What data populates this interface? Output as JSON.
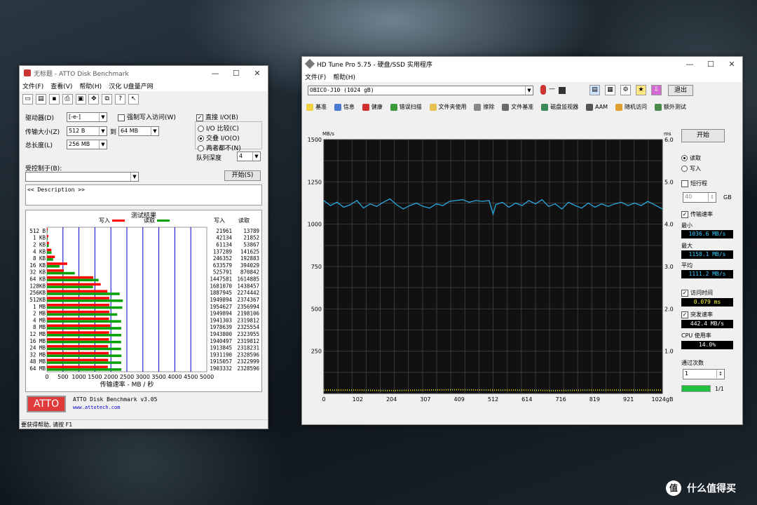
{
  "atto": {
    "title": "无标题 - ATTO Disk Benchmark",
    "menu": [
      "文件(F)",
      "查看(V)",
      "帮助(H)",
      "汉化 U盘量产网"
    ],
    "drive_label": "驱动器(D)",
    "drive_value": "[-e-]",
    "force_write_label": "强制写入访问(W)",
    "direct_io_label": "直接 I/O(B)",
    "transfer_label": "传输大小(Z)",
    "transfer_from": "512 B",
    "transfer_to_label": "到",
    "transfer_to": "64 MB",
    "total_label": "总长度(L)",
    "total_value": "256 MB",
    "io_compare": "I/O 比较(C)",
    "io_overlap": "交叠 I/O(O)",
    "io_neither": "两者都不(N)",
    "queue_label": "队列深度",
    "queue_value": "4",
    "controlled_label": "受控制于(B):",
    "start_button": "开始(S)",
    "description": "<< Description >>",
    "results_title": "测试结果",
    "legend_write": "写入",
    "legend_read": "读取",
    "col_write": "写入",
    "col_read": "读取",
    "sizes": [
      "512 B",
      "1 KB",
      "2 KB",
      "4 KB",
      "8 KB",
      "16 KB",
      "32 KB",
      "64 KB",
      "128KB",
      "256KB",
      "512KB",
      "1 MB",
      "2 MB",
      "4 MB",
      "8 MB",
      "12 MB",
      "16 MB",
      "24 MB",
      "32 MB",
      "48 MB",
      "64 MB"
    ],
    "write": [
      "21961",
      "42134",
      "61134",
      "137289",
      "246352",
      "633579",
      "525791",
      "1447581",
      "1681070",
      "1887945",
      "1949894",
      "1954627",
      "1949894",
      "1941303",
      "1978639",
      "1943800",
      "1940497",
      "1913845",
      "1931190",
      "1915057",
      "1903332"
    ],
    "read": [
      "13789",
      "21852",
      "53867",
      "141625",
      "192883",
      "394029",
      "870842",
      "1614885",
      "1438457",
      "2274442",
      "2374367",
      "2356994",
      "2198106",
      "2319812",
      "2325554",
      "2323955",
      "2319812",
      "2318231",
      "2328596",
      "2322999",
      "2328596"
    ],
    "x_ticks": [
      "0",
      "500",
      "1000",
      "1500",
      "2000",
      "2500",
      "3000",
      "3500",
      "4000",
      "4500",
      "5000"
    ],
    "x_axis_label": "传输速率 - MB / 秒",
    "logo": "ATTO",
    "product": "ATTO Disk Benchmark v3.05",
    "url": "www.attotech.com",
    "status": "要获得帮助, 请按 F1",
    "colors": {
      "write": "#ff0000",
      "read": "#00a000",
      "grid": "#0000cc"
    }
  },
  "hdtune": {
    "title": "HD Tune Pro 5.75 - 硬盘/SSD 实用程序",
    "menu": [
      "文件(F)",
      "帮助(H)"
    ],
    "drive": "OBICO-J10 (1024 gB)",
    "temp": "—",
    "exit_button": "退出",
    "tabs": [
      {
        "label": "基准",
        "icon": "bulb-icon"
      },
      {
        "label": "信息",
        "icon": "info-icon"
      },
      {
        "label": "健康",
        "icon": "health-icon"
      },
      {
        "label": "错误扫描",
        "icon": "scan-icon"
      },
      {
        "label": "文件夹使用",
        "icon": "folder-icon"
      },
      {
        "label": "擦除",
        "icon": "erase-icon"
      },
      {
        "label": "文件基准",
        "icon": "file-icon"
      },
      {
        "label": "磁盘监视器",
        "icon": "monitor-icon"
      },
      {
        "label": "AAM",
        "icon": "speaker-icon"
      },
      {
        "label": "随机访问",
        "icon": "random-icon"
      },
      {
        "label": "额外测试",
        "icon": "extra-icon"
      }
    ],
    "y_unit": "MB/s",
    "y2_unit": "ms",
    "y_ticks": [
      "1500",
      "1250",
      "1000",
      "750",
      "500",
      "250"
    ],
    "y2_ticks": [
      "6.00",
      "5.00",
      "4.00",
      "3.00",
      "2.00",
      "1.00"
    ],
    "x_ticks": [
      "0",
      "102",
      "204",
      "307",
      "409",
      "512",
      "614",
      "716",
      "819",
      "921",
      "1024gB"
    ],
    "start_button": "开始",
    "read_label": "读取",
    "write_label": "写入",
    "short_stroke_label": "短行程",
    "short_stroke_value": "40",
    "gb_label": "GB",
    "transfer_rate_label": "传输速率",
    "min_label": "最小",
    "min_value": "1036.6 MB/s",
    "max_label": "最大",
    "max_value": "1158.1 MB/s",
    "avg_label": "平均",
    "avg_value": "1111.2 MB/s",
    "access_time_label": "访问时间",
    "access_time_value": "0.079 ms",
    "burst_label": "突发速率",
    "burst_value": "442.4 MB/s",
    "cpu_label": "CPU 使用率",
    "cpu_value": "14.0%",
    "passes_label": "通过次数",
    "passes_value": "1",
    "progress_text": "1/1",
    "progress_fraction": 1.0
  },
  "chart_data": [
    {
      "type": "bar",
      "title": "测试结果",
      "xlabel": "传输速率 - MB / 秒",
      "xlim": [
        0,
        5000
      ],
      "categories": [
        "512 B",
        "1 KB",
        "2 KB",
        "4 KB",
        "8 KB",
        "16 KB",
        "32 KB",
        "64 KB",
        "128KB",
        "256KB",
        "512KB",
        "1 MB",
        "2 MB",
        "4 MB",
        "8 MB",
        "12 MB",
        "16 MB",
        "24 MB",
        "32 MB",
        "48 MB",
        "64 MB"
      ],
      "series": [
        {
          "name": "写入",
          "values": [
            21.961,
            42.134,
            61.134,
            137.289,
            246.352,
            633.579,
            525.791,
            1447.581,
            1681.07,
            1887.945,
            1949.894,
            1954.627,
            1949.894,
            1941.303,
            1978.639,
            1943.8,
            1940.497,
            1913.845,
            1931.19,
            1915.057,
            1903.332
          ]
        },
        {
          "name": "读取",
          "values": [
            13.789,
            21.852,
            53.867,
            141.625,
            192.883,
            394.029,
            870.842,
            1614.885,
            1438.457,
            2274.442,
            2374.367,
            2356.994,
            2198.106,
            2319.812,
            2325.554,
            2323.955,
            2319.812,
            2318.231,
            2328.596,
            2322.999,
            2328.596
          ]
        }
      ]
    },
    {
      "type": "line",
      "ylabel": "MB/s",
      "ylim": [
        0,
        1500
      ],
      "y2label": "ms",
      "y2lim": [
        0,
        6
      ],
      "xlim": [
        0,
        1024
      ],
      "grid": true,
      "series": [
        {
          "name": "传输速率",
          "x": [
            0,
            20,
            40,
            60,
            80,
            100,
            120,
            140,
            160,
            180,
            200,
            220,
            240,
            260,
            280,
            300,
            320,
            340,
            360,
            380,
            400,
            420,
            440,
            460,
            480,
            500,
            512,
            520,
            540,
            560,
            580,
            600,
            620,
            640,
            660,
            680,
            700,
            720,
            740,
            760,
            780,
            800,
            820,
            840,
            860,
            880,
            900,
            920,
            940,
            960,
            980,
            1000,
            1024
          ],
          "y": [
            1140,
            1110,
            1130,
            1100,
            1115,
            1140,
            1095,
            1120,
            1105,
            1130,
            1150,
            1115,
            1090,
            1110,
            1125,
            1105,
            1095,
            1120,
            1110,
            1135,
            1140,
            1145,
            1130,
            1140,
            1135,
            1140,
            1060,
            1115,
            1130,
            1100,
            1125,
            1110,
            1140,
            1120,
            1145,
            1105,
            1120,
            1090,
            1130,
            1110,
            1095,
            1125,
            1100,
            1120,
            1105,
            1120,
            1130,
            1110,
            1125,
            1110,
            1135,
            1115,
            1090
          ]
        },
        {
          "name": "访问时间",
          "x": [
            0,
            100,
            200,
            300,
            400,
            500,
            600,
            700,
            800,
            900,
            1024
          ],
          "y": [
            0.08,
            0.08,
            0.07,
            0.08,
            0.09,
            0.08,
            0.08,
            0.07,
            0.08,
            0.08,
            0.08
          ]
        }
      ]
    }
  ]
}
